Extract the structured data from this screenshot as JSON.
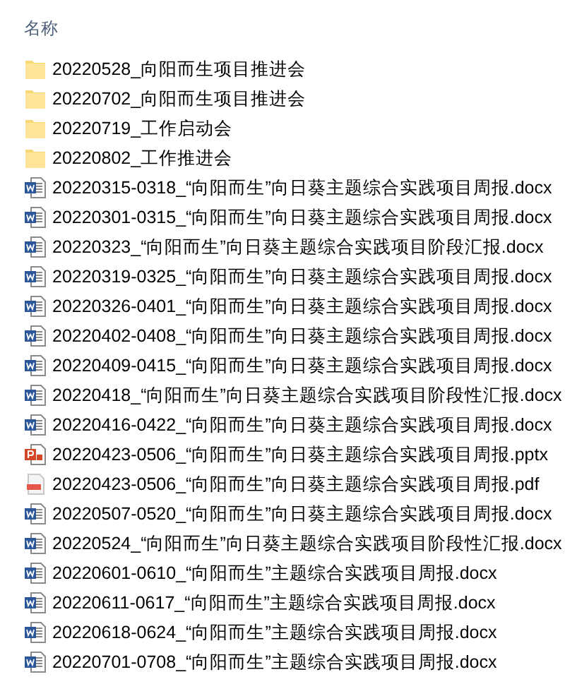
{
  "header": {
    "label": "名称"
  },
  "files": [
    {
      "kind": "folder",
      "name": "20220528_向阳而生项目推进会"
    },
    {
      "kind": "folder",
      "name": "20220702_向阳而生项目推进会"
    },
    {
      "kind": "folder",
      "name": "20220719_工作启动会"
    },
    {
      "kind": "folder",
      "name": "20220802_工作推进会"
    },
    {
      "kind": "word",
      "name": "20220315-0318_“向阳而生”向日葵主题综合实践项目周报.docx"
    },
    {
      "kind": "word",
      "name": "20220301-0315_“向阳而生”向日葵主题综合实践项目周报.docx"
    },
    {
      "kind": "word",
      "name": "20220323_“向阳而生”向日葵主题综合实践项目阶段汇报.docx"
    },
    {
      "kind": "word",
      "name": "20220319-0325_“向阳而生”向日葵主题综合实践项目周报.docx"
    },
    {
      "kind": "word",
      "name": "20220326-0401_“向阳而生”向日葵主题综合实践项目周报.docx"
    },
    {
      "kind": "word",
      "name": "20220402-0408_“向阳而生”向日葵主题综合实践项目周报.docx"
    },
    {
      "kind": "word",
      "name": "20220409-0415_“向阳而生”向日葵主题综合实践项目周报.docx"
    },
    {
      "kind": "word",
      "name": "20220418_“向阳而生”向日葵主题综合实践项目阶段性汇报.docx"
    },
    {
      "kind": "word",
      "name": "20220416-0422_“向阳而生”向日葵主题综合实践项目周报.docx"
    },
    {
      "kind": "ppt",
      "name": "20220423-0506_“向阳而生”向日葵主题综合实践项目周报.pptx"
    },
    {
      "kind": "pdf",
      "name": "20220423-0506_“向阳而生”向日葵主题综合实践项目周报.pdf"
    },
    {
      "kind": "word",
      "name": "20220507-0520_“向阳而生”向日葵主题综合实践项目周报.docx"
    },
    {
      "kind": "word",
      "name": "20220524_“向阳而生”向日葵主题综合实践项目阶段性汇报.docx"
    },
    {
      "kind": "word",
      "name": "20220601-0610_“向阳而生”主题综合实践项目周报.docx"
    },
    {
      "kind": "word",
      "name": "20220611-0617_“向阳而生”主题综合实践项目周报.docx"
    },
    {
      "kind": "word",
      "name": "20220618-0624_“向阳而生”主题综合实践项目周报.docx"
    },
    {
      "kind": "word",
      "name": "20220701-0708_“向阳而生”主题综合实践项目周报.docx"
    }
  ]
}
